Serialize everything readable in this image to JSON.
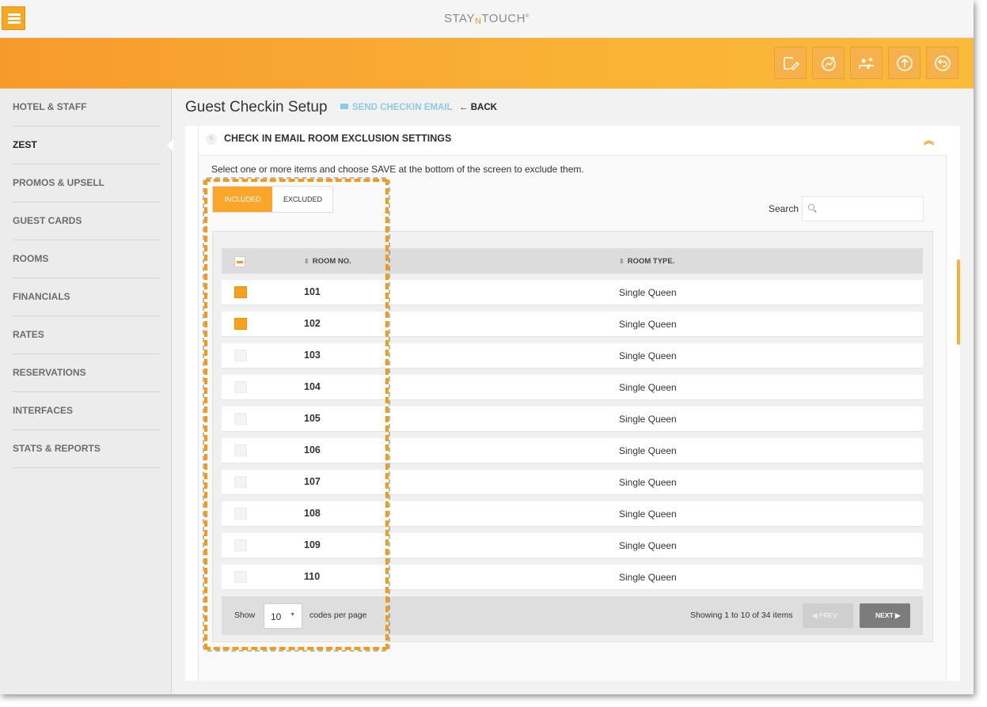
{
  "app": {
    "logo_a": "STAY",
    "logo_b": "N",
    "logo_c": "TOUCH",
    "logo_tm": "®"
  },
  "header": {
    "buttons": [
      {
        "icon": "edit-document-icon"
      },
      {
        "icon": "chart-star-icon"
      },
      {
        "icon": "staff-star-icon"
      },
      {
        "icon": "upload-circle-icon"
      },
      {
        "icon": "undo-circle-icon"
      }
    ]
  },
  "sidebar": {
    "items": [
      {
        "label": "HOTEL & STAFF"
      },
      {
        "label": "ZEST",
        "active": true
      },
      {
        "label": "PROMOS & UPSELL"
      },
      {
        "label": "GUEST CARDS"
      },
      {
        "label": "ROOMS"
      },
      {
        "label": "FINANCIALS"
      },
      {
        "label": "RATES"
      },
      {
        "label": "RESERVATIONS"
      },
      {
        "label": "INTERFACES"
      },
      {
        "label": "STATS & REPORTS"
      }
    ]
  },
  "page": {
    "title": "Guest Checkin Setup",
    "send_email": "SEND CHECKIN EMAIL",
    "back": "BACK",
    "back_arrow": "←"
  },
  "section": {
    "title": "CHECK IN EMAIL ROOM EXCLUSION SETTINGS",
    "collapse_glyph": "︽",
    "instructions": "Select one or more items and choose SAVE at the bottom of the screen to exclude them.",
    "tabs": {
      "included": "INCLUDED",
      "excluded": "EXCLUDED"
    },
    "search_label": "Search",
    "search_value": ""
  },
  "table": {
    "columns": {
      "room_no": "ROOM NO.",
      "room_type": "ROOM TYPE."
    },
    "rows": [
      {
        "room_no": "101",
        "room_type": "Single Queen",
        "checked": true
      },
      {
        "room_no": "102",
        "room_type": "Single Queen",
        "checked": true
      },
      {
        "room_no": "103",
        "room_type": "Single Queen",
        "checked": false
      },
      {
        "room_no": "104",
        "room_type": "Single Queen",
        "checked": false
      },
      {
        "room_no": "105",
        "room_type": "Single Queen",
        "checked": false
      },
      {
        "room_no": "106",
        "room_type": "Single Queen",
        "checked": false
      },
      {
        "room_no": "107",
        "room_type": "Single Queen",
        "checked": false
      },
      {
        "room_no": "108",
        "room_type": "Single Queen",
        "checked": false
      },
      {
        "room_no": "109",
        "room_type": "Single Queen",
        "checked": false
      },
      {
        "room_no": "110",
        "room_type": "Single Queen",
        "checked": false
      }
    ]
  },
  "pagination": {
    "show": "Show",
    "per_page": "10",
    "per_page_label": "codes per page",
    "showing": "Showing 1 to 10 of 34 items",
    "prev": "PREV",
    "next": "NEXT"
  },
  "colors": {
    "accent": "#f9a62a",
    "link": "#8ccbe6"
  }
}
